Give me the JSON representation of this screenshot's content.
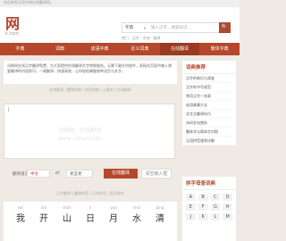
{
  "topbar": {
    "text": "欢迎来到汉语字典在线翻译网。"
  },
  "header": {
    "logo": "网",
    "logo_sub": "k.com",
    "search_select": "字典",
    "search_placeholder": "输入汉字，搜索知识...",
    "search_button": "🔍",
    "hot_words": "热门 · 汉字 · 古诗 · 翻译"
  },
  "nav": [
    "字典",
    "词典",
    "成语字典",
    "近义词典",
    "在线翻译",
    "繁体字典"
  ],
  "intro": {
    "text": "词典网在线汉字翻译免费，为大家提供在线翻译文字转换服务。无需下载任何软件，直接在页面中输入想要翻译的内容即可，一键翻译，快速高效，让你轻松掌握各种语言与文字。"
  },
  "tabs": {
    "text": "在线翻译 | 繁简转换 | 拼音转换 | 火星文 | 在线翻译"
  },
  "translator": {
    "cursor": "|",
    "watermark1": "词典网 · 在线翻译",
    "watermark2": "www.cidian.com",
    "label": "翻译语言",
    "from_lang": "中文",
    "swap": "⇄",
    "to_lang": "文言文",
    "translate_button": "在线翻译",
    "clear_button": "清空输入框"
  },
  "sec2": {
    "tabs": "汉字翻译 | 翻译拼音 | 汉字拼音 | 组词造句"
  },
  "chars": [
    {
      "py": "wǒ",
      "ch": "我"
    },
    {
      "py": "kāi",
      "ch": "开"
    },
    {
      "py": "shān",
      "ch": "山"
    },
    {
      "py": "rì",
      "ch": "日"
    },
    {
      "py": "yuè",
      "ch": "月"
    },
    {
      "py": "shuǐ",
      "ch": "水"
    },
    {
      "py": "qīng",
      "ch": "清"
    }
  ],
  "side": {
    "title": "词典推荐",
    "items": [
      "汉字的来历与演变",
      "汉字的书写规范",
      "常用汉字一览表",
      "成语故事大全",
      "文言文翻译技巧",
      "诗词名句赏析",
      "繁体字与简体字对照",
      "汉语拼音规则详解"
    ]
  },
  "pinyin": {
    "title": "拼字母查词典",
    "letters": [
      "A",
      "B",
      "C",
      "D",
      "E",
      "F",
      "G",
      "H",
      "J",
      "K",
      "L",
      "M"
    ]
  }
}
